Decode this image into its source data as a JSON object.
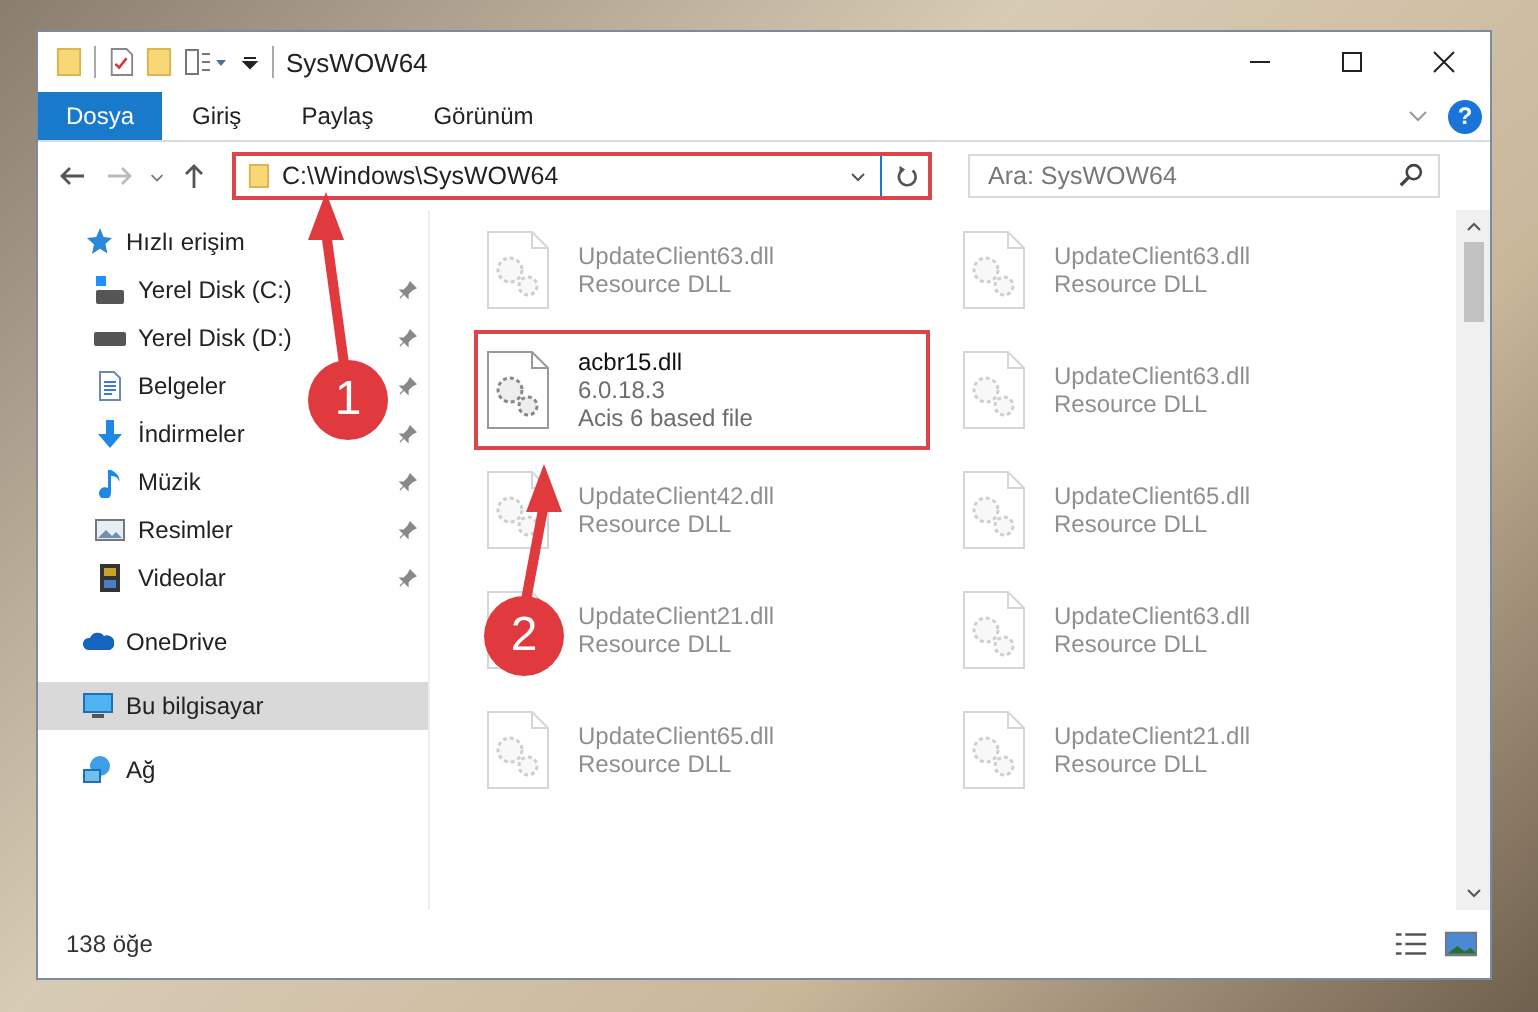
{
  "window": {
    "title": "SysWOW64"
  },
  "ribbon_tabs": [
    {
      "label": "Dosya",
      "selected": true
    },
    {
      "label": "Giriş",
      "selected": false
    },
    {
      "label": "Paylaş",
      "selected": false
    },
    {
      "label": "Görünüm",
      "selected": false
    }
  ],
  "address": {
    "path": "C:\\Windows\\SysWOW64"
  },
  "search": {
    "placeholder": "Ara: SysWOW64"
  },
  "help_button": {
    "label": "?"
  },
  "sidebar": {
    "items": [
      {
        "label": "Hızlı erişim",
        "kind": "quick",
        "selected": false,
        "children": [
          {
            "label": "Yerel Disk (C:)",
            "kind": "system-drive",
            "pinned": true,
            "selected": false
          },
          {
            "label": "Yerel Disk (D:)",
            "kind": "drive",
            "pinned": true,
            "selected": false
          },
          {
            "label": "Belgeler",
            "kind": "documents",
            "pinned": true,
            "selected": false
          },
          {
            "label": "İndirmeler",
            "kind": "downloads",
            "pinned": true,
            "selected": false
          },
          {
            "label": "Müzik",
            "kind": "music",
            "pinned": true,
            "selected": false
          },
          {
            "label": "Resimler",
            "kind": "pictures",
            "pinned": true,
            "selected": false
          },
          {
            "label": "Videolar",
            "kind": "videos",
            "pinned": true,
            "selected": false
          }
        ]
      },
      {
        "label": "OneDrive",
        "kind": "cloud",
        "selected": false
      },
      {
        "label": "Bu bilgisayar",
        "kind": "computer",
        "selected": true
      },
      {
        "label": "Ağ",
        "kind": "network",
        "selected": false
      }
    ]
  },
  "files": [
    {
      "name": "UpdateClient63.dll",
      "detail": [
        "Resource DLL"
      ],
      "highlighted": false
    },
    {
      "name": "UpdateClient63.dll",
      "detail": [
        "Resource DLL"
      ],
      "highlighted": false
    },
    {
      "name": "acbr15.dll",
      "detail": [
        "6.0.18.3",
        "Acis 6 based file"
      ],
      "highlighted": true
    },
    {
      "name": "UpdateClient63.dll",
      "detail": [
        "Resource DLL"
      ],
      "highlighted": false
    },
    {
      "name": "UpdateClient42.dll",
      "detail": [
        "Resource DLL"
      ],
      "highlighted": false
    },
    {
      "name": "UpdateClient65.dll",
      "detail": [
        "Resource DLL"
      ],
      "highlighted": false
    },
    {
      "name": "UpdateClient21.dll",
      "detail": [
        "Resource DLL"
      ],
      "highlighted": false
    },
    {
      "name": "UpdateClient63.dll",
      "detail": [
        "Resource DLL"
      ],
      "highlighted": false
    },
    {
      "name": "UpdateClient65.dll",
      "detail": [
        "Resource DLL"
      ],
      "highlighted": false
    },
    {
      "name": "UpdateClient21.dll",
      "detail": [
        "Resource DLL"
      ],
      "highlighted": false
    }
  ],
  "annotations": [
    {
      "number": "1"
    },
    {
      "number": "2"
    }
  ],
  "status_bar": {
    "count": "138 öğe"
  }
}
